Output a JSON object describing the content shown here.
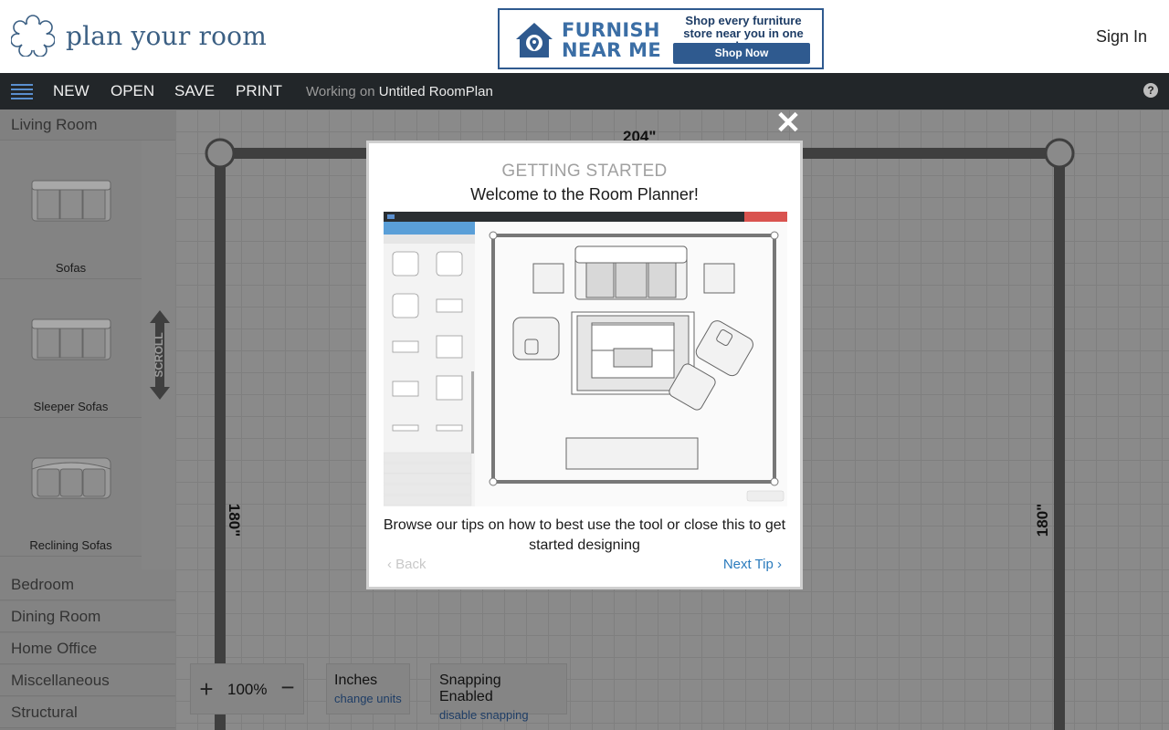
{
  "header": {
    "logo_text": "plan your room",
    "sign_in": "Sign In",
    "ad": {
      "brand_line1": "FURNISH",
      "brand_line2": "NEAR ME",
      "tagline": "Shop every furniture store near you in one place",
      "button": "Shop Now"
    }
  },
  "toolbar": {
    "new": "NEW",
    "open": "OPEN",
    "save": "SAVE",
    "print": "PRINT",
    "working_prefix": "Working on",
    "plan_name": "Untitled RoomPlan",
    "help": "?"
  },
  "sidebar": {
    "active_category": "Living Room",
    "items": [
      {
        "label": "Sofas",
        "icon": "sofa-icon"
      },
      {
        "label": "Sleeper Sofas",
        "icon": "sleeper-sofa-icon"
      },
      {
        "label": "Reclining Sofas",
        "icon": "reclining-sofa-icon"
      }
    ],
    "scroll_label": "SCROLL",
    "categories": [
      "Bedroom",
      "Dining Room",
      "Home Office",
      "Miscellaneous",
      "Structural"
    ]
  },
  "canvas": {
    "top_dim": "204\"",
    "left_dim": "180\"",
    "right_dim": "180\""
  },
  "controls": {
    "zoom_in": "+",
    "zoom_value": "100%",
    "zoom_out": "−",
    "units": "Inches",
    "units_link": "change units",
    "snapping": "Snapping Enabled",
    "snapping_link": "disable snapping"
  },
  "modal": {
    "close": "✕",
    "title": "GETTING STARTED",
    "subtitle": "Welcome to the Room Planner!",
    "body": "Browse our tips on how to best use the tool or close this to get started designing",
    "back": "‹  Back",
    "next": "Next Tip  ›"
  },
  "colors": {
    "toolbar_bg": "#222629",
    "brand_blue": "#3b5f83",
    "link_blue": "#2b7bbd"
  }
}
